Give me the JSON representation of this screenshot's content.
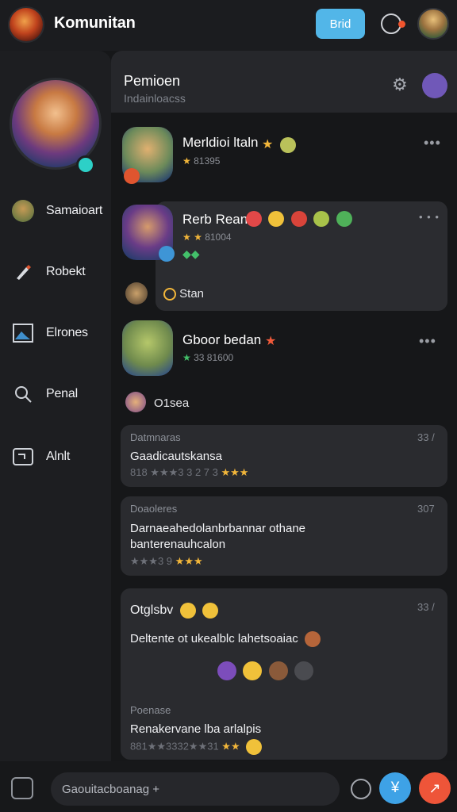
{
  "app": {
    "title": "Komunitan",
    "top_button": "Brid"
  },
  "sidebar": {
    "items": [
      {
        "label": "Samaioart",
        "icon": "avatar-icon"
      },
      {
        "label": "Robekt",
        "icon": "pen-icon"
      },
      {
        "label": "Elrones",
        "icon": "image-icon"
      },
      {
        "label": "Penal",
        "icon": "search-icon"
      },
      {
        "label": "Alnlt",
        "icon": "folder-icon"
      }
    ]
  },
  "header": {
    "title": "Pemioen",
    "subtitle": "Indainloacss"
  },
  "posts": [
    {
      "name": "Merldioi ltaln",
      "meta": "81395"
    },
    {
      "name": "Rerb Rean",
      "meta": "81004",
      "reply_label": "Stan"
    },
    {
      "name": "Gboor bedan",
      "meta": "33 81600",
      "reply_label": "O1sea"
    }
  ],
  "cards": [
    {
      "header": "Datmnaras",
      "count": "33 /",
      "body": "Gaadicautskansa",
      "stars": "818 ★★★3 3 2 7 3"
    },
    {
      "header": "Doaoleres",
      "count": "307",
      "body": "Darnaeahedolanbrbannar othane banterenauhcalon",
      "stars": "★★★3 9"
    },
    {
      "header": "Otglsbv",
      "count": "33 /",
      "body": "Deltente ot ukealblc  lahetsoaiac",
      "footer_title": "Poenase",
      "footer_body": "Renakervane lba arlalpis",
      "footer_stars": "881★★3332★★31"
    }
  ],
  "composer": {
    "placeholder": "Gaouitacboanag +"
  }
}
